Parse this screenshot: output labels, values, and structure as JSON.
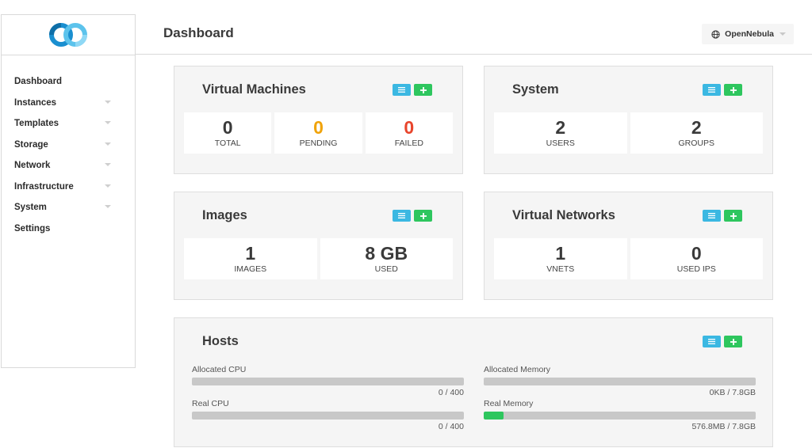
{
  "sidebar": {
    "items": [
      {
        "label": "Dashboard",
        "has_caret": false
      },
      {
        "label": "Instances",
        "has_caret": true
      },
      {
        "label": "Templates",
        "has_caret": true
      },
      {
        "label": "Storage",
        "has_caret": true
      },
      {
        "label": "Network",
        "has_caret": true
      },
      {
        "label": "Infrastructure",
        "has_caret": true
      },
      {
        "label": "System",
        "has_caret": true
      },
      {
        "label": "Settings",
        "has_caret": false
      }
    ]
  },
  "header": {
    "title": "Dashboard",
    "zone_label": "OpenNebula",
    "zone_icon": "globe-icon"
  },
  "colors": {
    "list_button": "#3bb8e2",
    "add_button": "#2ec65e",
    "pending": "#f0a30a",
    "failed": "#e8452c",
    "meter_fill": "#2ec65e"
  },
  "panels": {
    "vms": {
      "title": "Virtual Machines",
      "stats": [
        {
          "value": "0",
          "label": "TOTAL"
        },
        {
          "value": "0",
          "label": "PENDING"
        },
        {
          "value": "0",
          "label": "FAILED"
        }
      ]
    },
    "system": {
      "title": "System",
      "stats": [
        {
          "value": "2",
          "label": "USERS"
        },
        {
          "value": "2",
          "label": "GROUPS"
        }
      ]
    },
    "images": {
      "title": "Images",
      "stats": [
        {
          "value": "1",
          "label": "IMAGES"
        },
        {
          "value": "8 GB",
          "label": "USED"
        }
      ]
    },
    "vnets": {
      "title": "Virtual Networks",
      "stats": [
        {
          "value": "1",
          "label": "VNETS"
        },
        {
          "value": "0",
          "label": "USED IPs"
        }
      ]
    },
    "hosts": {
      "title": "Hosts",
      "meters": {
        "alloc_cpu": {
          "label": "Allocated CPU",
          "value": "0 / 400",
          "fraction": 0
        },
        "real_cpu": {
          "label": "Real CPU",
          "value": "0 / 400",
          "fraction": 0
        },
        "alloc_mem": {
          "label": "Allocated Memory",
          "value": "0KB / 7.8GB",
          "fraction": 0
        },
        "real_mem": {
          "label": "Real Memory",
          "value": "576.8MB / 7.8GB",
          "fraction": 0.072
        }
      }
    }
  }
}
